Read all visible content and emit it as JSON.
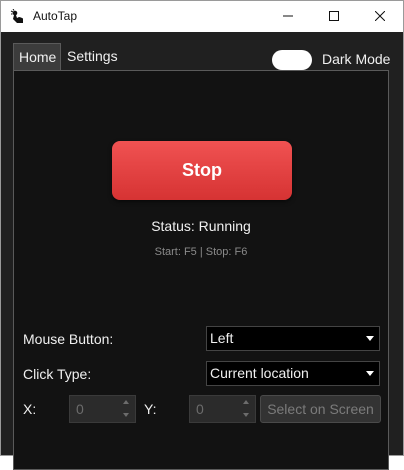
{
  "window": {
    "title": "AutoTap"
  },
  "tabs": {
    "home": "Home",
    "settings": "Settings"
  },
  "dark_mode": {
    "label": "Dark Mode",
    "enabled": false
  },
  "main": {
    "stop_label": "Stop",
    "status": "Status: Running",
    "hotkeys": "Start: F5 | Stop: F6"
  },
  "settings": {
    "mouse_button_label": "Mouse Button:",
    "mouse_button_value": "Left",
    "click_type_label": "Click Type:",
    "click_type_value": "Current location",
    "x_label": "X:",
    "x_value": "0",
    "y_label": "Y:",
    "y_value": "0",
    "select_on_screen": "Select on Screen"
  },
  "colors": {
    "accent": "#e84545",
    "panel_bg": "#121212",
    "window_bg": "#202020"
  }
}
